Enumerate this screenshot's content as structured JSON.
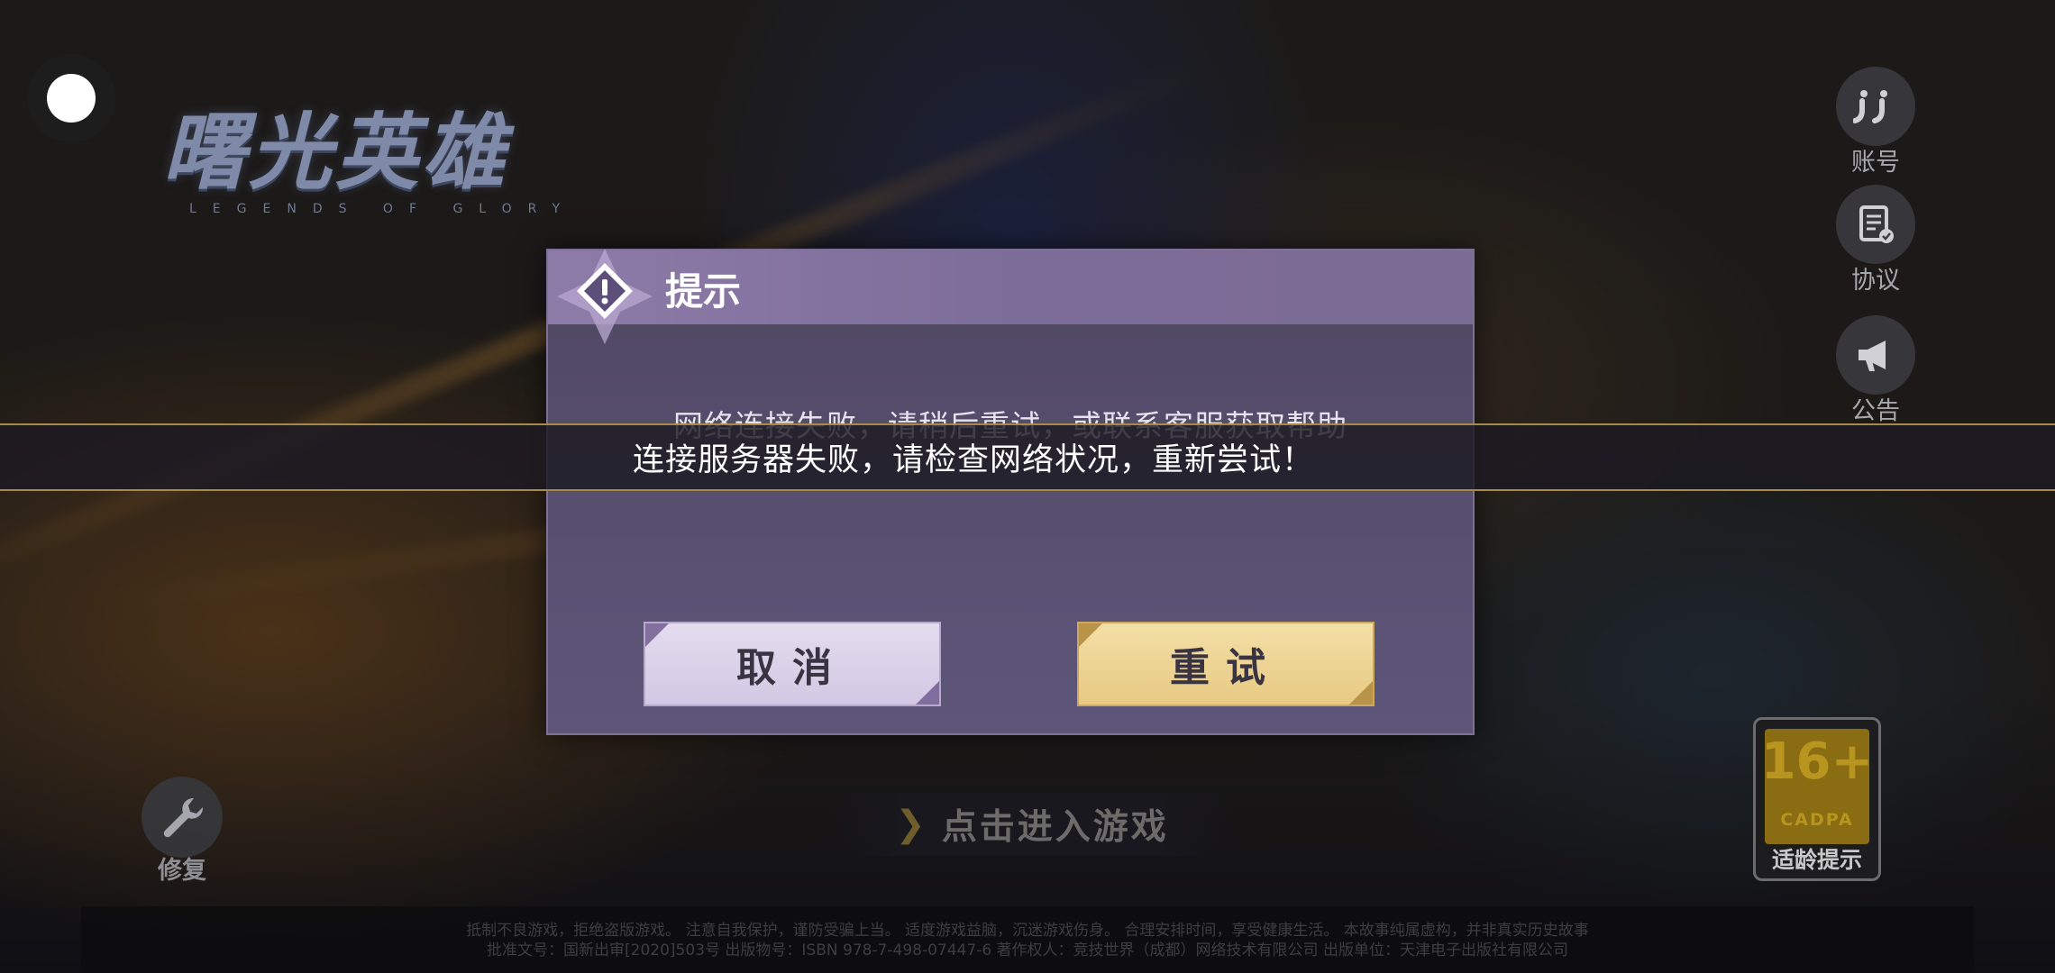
{
  "game": {
    "logo_cn": "曙光英雄",
    "logo_en": "LEGENDS OF GLORY"
  },
  "side_menu": {
    "account": {
      "label": "账号",
      "icon": "account-icon"
    },
    "agreement": {
      "label": "协议",
      "icon": "agreement-icon"
    },
    "notice": {
      "label": "公告",
      "icon": "megaphone-icon"
    }
  },
  "repair": {
    "label": "修复",
    "icon": "wrench-icon"
  },
  "age_rating": {
    "age": "16+",
    "org": "CADPA",
    "label": "适龄提示"
  },
  "start": {
    "label": "点击进入游戏"
  },
  "legal": {
    "line1": "抵制不良游戏，拒绝盗版游戏。 注意自我保护，谨防受骗上当。 适度游戏益脑，沉迷游戏伤身。 合理安排时间，享受健康生活。 本故事纯属虚构，并非真实历史故事",
    "line2": "批准文号：国新出审[2020]503号 出版物号：ISBN 978-7-498-07447-6 著作权人：竞技世界（成都）网络技术有限公司 出版单位：天津电子出版社有限公司"
  },
  "dialog": {
    "title": "提示",
    "message": "网络连接失败，请稍后重试，或联系客服获取帮助",
    "cancel_label": "取消",
    "retry_label": "重试"
  },
  "toast": {
    "text": "连接服务器失败，请检查网络状况，重新尝试！"
  },
  "colors": {
    "dialog_bg": "#585070",
    "dialog_header": "#8d7ba8",
    "cancel_btn": "#ddd3ea",
    "retry_btn": "#edd393",
    "toast_border": "#a78a4a"
  }
}
